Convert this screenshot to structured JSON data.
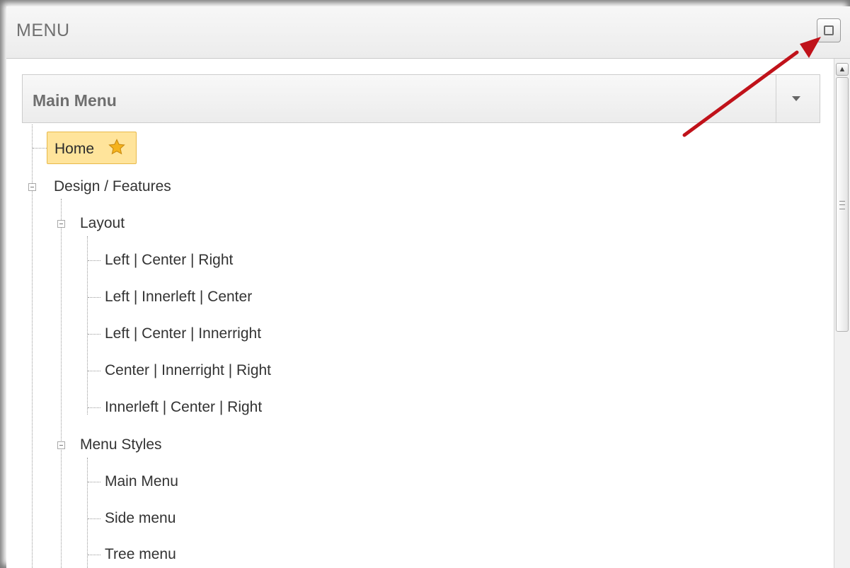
{
  "panel": {
    "title": "MENU",
    "maximize_icon": "maximize-icon"
  },
  "menu_select": {
    "selected": "Main Menu",
    "icon": "chevron-down-icon"
  },
  "tree": {
    "home": {
      "label": "Home",
      "icon": "star-icon",
      "selected": true
    },
    "design_features": {
      "label": "Design / Features",
      "expanded": true,
      "layout": {
        "label": "Layout",
        "expanded": true,
        "items": [
          "Left | Center | Right",
          "Left | Innerleft | Center",
          "Left | Center | Innerright",
          "Center | Innerright | Right",
          "Innerleft | Center | Right"
        ]
      },
      "menu_styles": {
        "label": "Menu Styles",
        "expanded": true,
        "items": [
          "Main Menu",
          "Side menu",
          "Tree menu"
        ]
      }
    }
  },
  "annotation": {
    "icon": "arrow-icon",
    "color": "#c0121a"
  },
  "colors": {
    "highlight": "#ffe49b",
    "highlight_border": "#e8b94a",
    "star": "#f5b31d"
  }
}
